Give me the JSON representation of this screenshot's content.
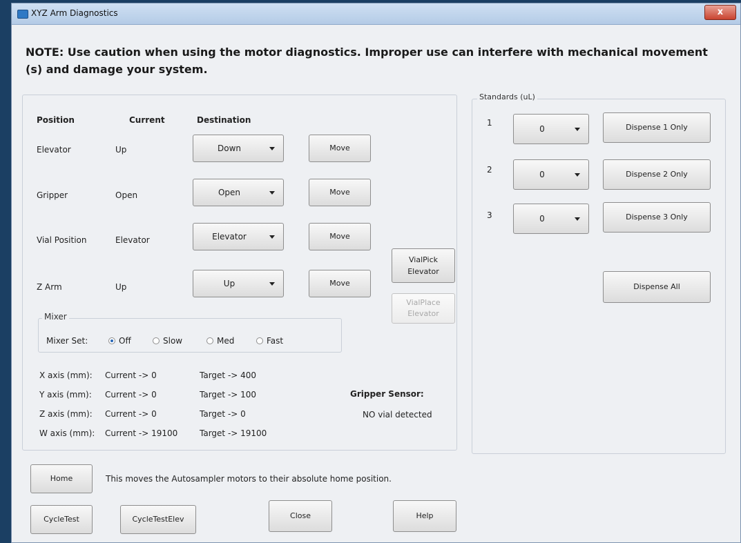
{
  "window": {
    "title": "XYZ Arm Diagnostics",
    "close_glyph": "x"
  },
  "note": "NOTE: Use caution when using the motor diagnostics. Improper use can interfere with mechanical movement (s) and damage your system.",
  "headers": {
    "position": "Position",
    "current": "Current",
    "destination": "Destination"
  },
  "rows": [
    {
      "position": "Elevator",
      "current": "Up",
      "destination": "Down",
      "move": "Move"
    },
    {
      "position": "Gripper",
      "current": "Open",
      "destination": "Open",
      "move": "Move"
    },
    {
      "position": "Vial Position",
      "current": "Elevator",
      "destination": "Elevator",
      "move": "Move"
    },
    {
      "position": "Z Arm",
      "current": "Up",
      "destination": "Up",
      "move": "Move"
    }
  ],
  "vial_pick": {
    "line1": "VialPick",
    "line2": "Elevator"
  },
  "vial_place": {
    "line1": "VialPlace",
    "line2": "Elevator"
  },
  "mixer": {
    "legend": "Mixer",
    "label": "Mixer Set:",
    "options": [
      "Off",
      "Slow",
      "Med",
      "Fast"
    ],
    "selected": "Off"
  },
  "axes": [
    {
      "label": "X axis (mm):",
      "current": "Current -> 0",
      "target": "Target ->  400"
    },
    {
      "label": "Y axis (mm):",
      "current": "Current -> 0",
      "target": "Target ->  100"
    },
    {
      "label": "Z axis (mm):",
      "current": "Current -> 0",
      "target": "Target ->  0"
    },
    {
      "label": "W axis (mm):",
      "current": "Current -> 19100",
      "target": "Target ->  19100"
    }
  ],
  "gripper_sensor": {
    "label": "Gripper Sensor:",
    "value": "NO vial detected"
  },
  "standards": {
    "legend": "Standards (uL)",
    "items": [
      {
        "num": "1",
        "value": "0",
        "button": "Dispense 1 Only"
      },
      {
        "num": "2",
        "value": "0",
        "button": "Dispense 2 Only"
      },
      {
        "num": "3",
        "value": "0",
        "button": "Dispense 3 Only"
      }
    ],
    "dispense_all": "Dispense All"
  },
  "bottom": {
    "home": "Home",
    "home_desc": "This moves the Autosampler motors to their absolute home position.",
    "cycle_test": "CycleTest",
    "cycle_test_elev": "CycleTestElev",
    "close": "Close",
    "help": "Help"
  },
  "colors": {
    "selected_radio": "#2767b7",
    "disabled_text": "#a8a8a8"
  }
}
